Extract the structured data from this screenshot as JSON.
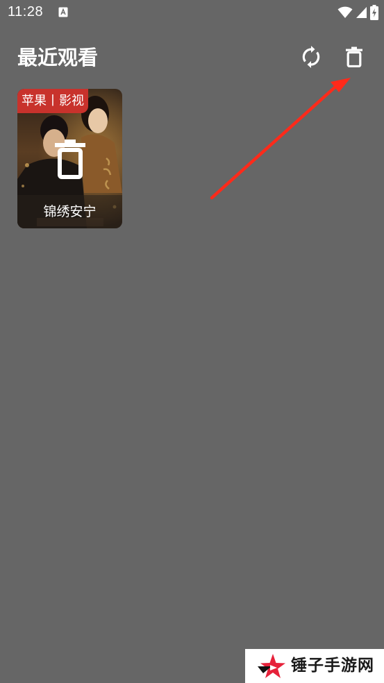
{
  "status_bar": {
    "time": "11:28",
    "notification_icon": "accessibility-notification-icon",
    "wifi_icon": "wifi-icon",
    "signal_icon": "cell-signal-icon",
    "battery_icon": "battery-charging-icon"
  },
  "header": {
    "title": "最近观看",
    "refresh_icon": "refresh-icon",
    "delete_icon": "trash-icon"
  },
  "history": {
    "items": [
      {
        "title": "锦绣安宁",
        "badge": "苹果丨影视",
        "overlay_icon": "trash-icon"
      }
    ]
  },
  "annotation": {
    "color": "#ff2a1a",
    "points_to": "delete-button"
  },
  "watermark": {
    "text": "锤子手游网",
    "logo_icon": "star-logo-icon"
  },
  "colors": {
    "background": "#666666",
    "badge": "#c8322c",
    "text": "#ffffff"
  }
}
